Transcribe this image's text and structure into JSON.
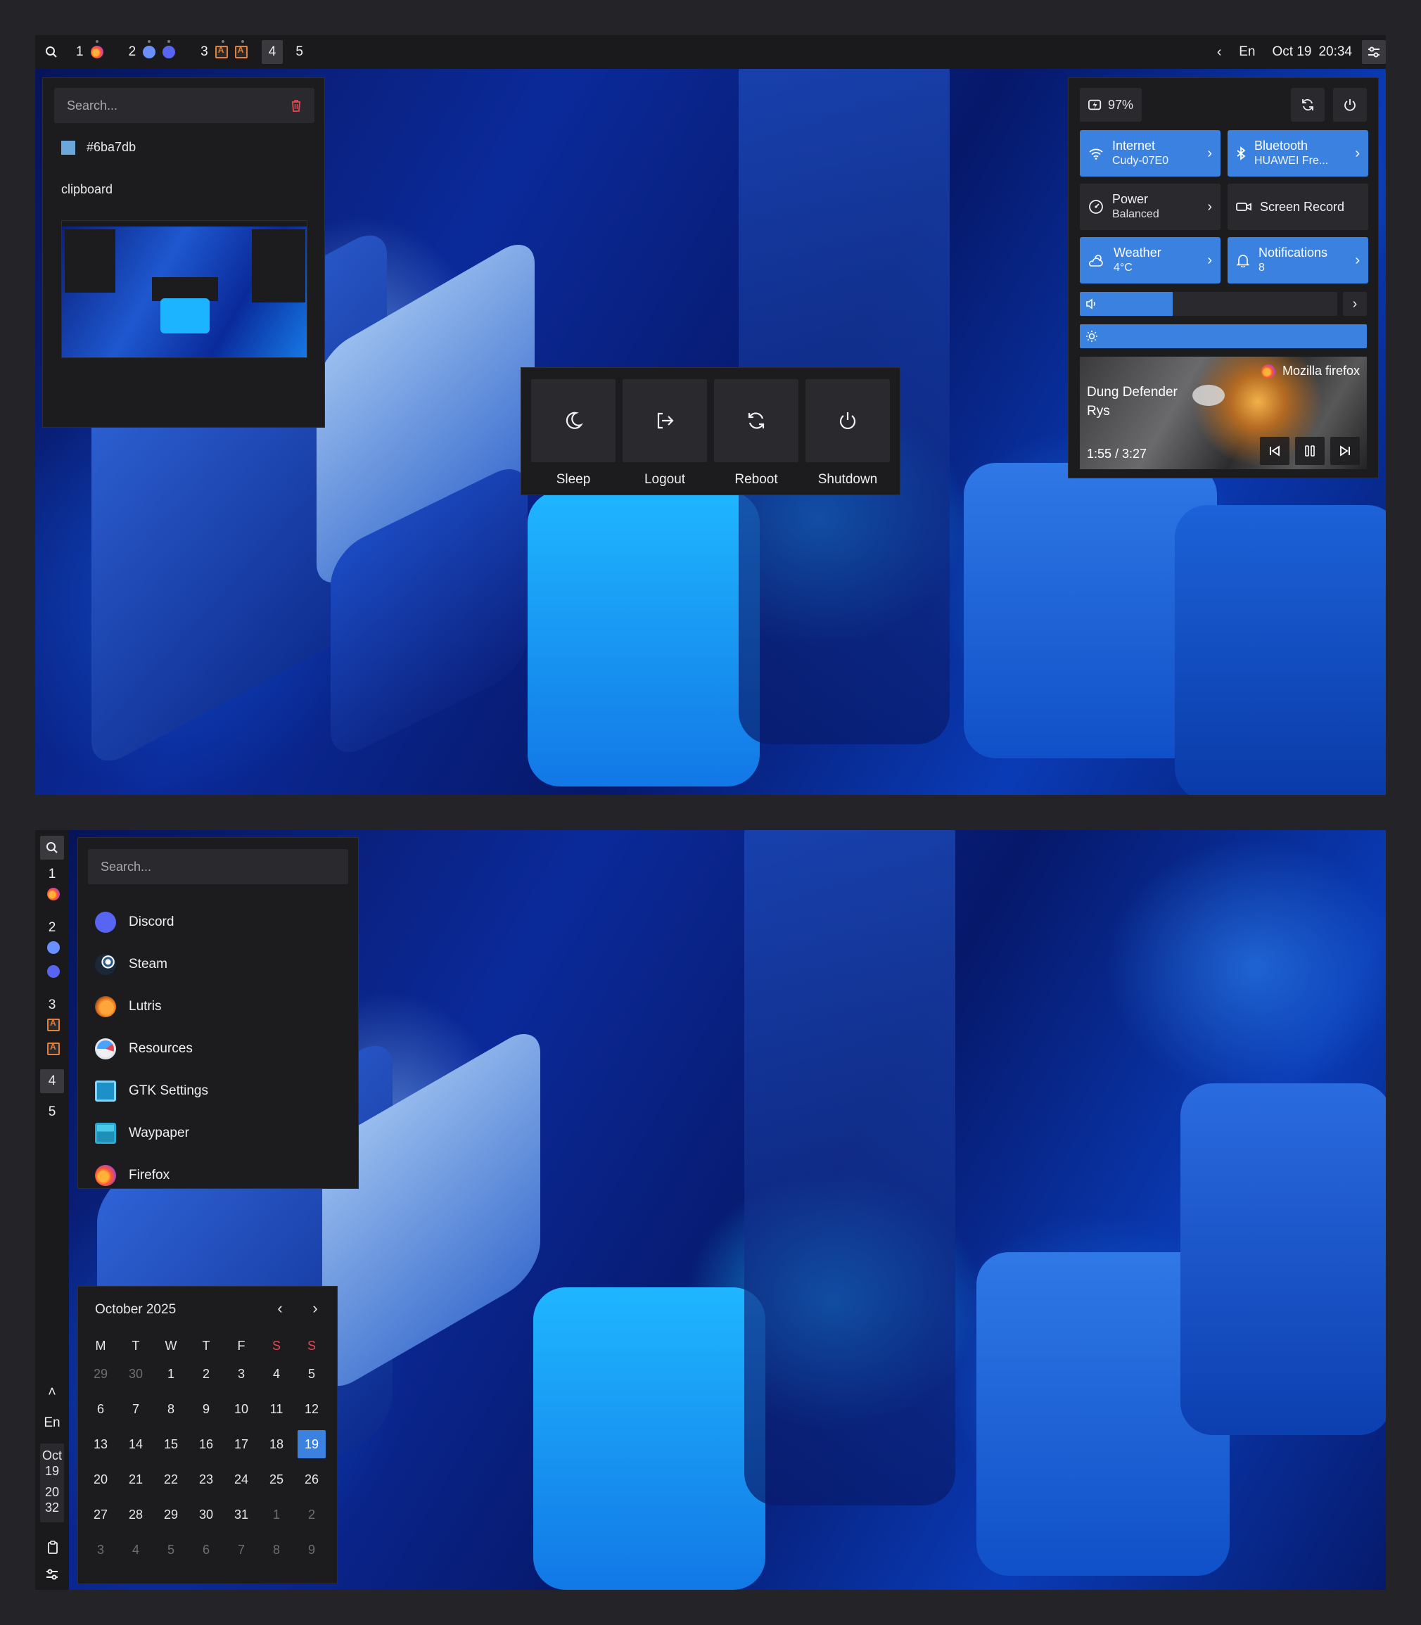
{
  "top_bar": {
    "workspaces": [
      {
        "num": "1",
        "apps": [
          "firefox-icon"
        ]
      },
      {
        "num": "2",
        "apps": [
          "transmission-icon",
          "discord-icon"
        ]
      },
      {
        "num": "3",
        "apps": [
          "ai-icon",
          "ai-icon"
        ]
      },
      {
        "num": "4",
        "apps": [],
        "active": true
      },
      {
        "num": "5",
        "apps": []
      }
    ],
    "lang": "En",
    "date": "Oct 19",
    "time": "20:34"
  },
  "clipboard": {
    "search_placeholder": "Search...",
    "items": [
      "#6ba7db",
      "clipboard"
    ],
    "swatch_color": "#6ba7db"
  },
  "power_menu": {
    "buttons": [
      "Sleep",
      "Logout",
      "Reboot",
      "Shutdown"
    ]
  },
  "quick_settings": {
    "battery": "97%",
    "tiles": [
      {
        "title": "Internet",
        "sub": "Cudy-07E0",
        "on": true
      },
      {
        "title": "Bluetooth",
        "sub": "HUAWEI Fre...",
        "on": true
      },
      {
        "title": "Power",
        "sub": "Balanced",
        "on": false
      },
      {
        "title": "Screen Record",
        "sub": "",
        "on": false
      },
      {
        "title": "Weather",
        "sub": "4°C",
        "on": true
      },
      {
        "title": "Notifications",
        "sub": "8",
        "on": true
      }
    ],
    "volume_level": 0.36,
    "brightness_level": 1.0,
    "media": {
      "player": "Mozilla firefox",
      "title": "Dung Defender",
      "artist": "Rys",
      "position": "1:55 / 3:27"
    }
  },
  "launcher": {
    "search_placeholder": "Search...",
    "apps": [
      "Discord",
      "Steam",
      "Lutris",
      "Resources",
      "GTK Settings",
      "Waypaper",
      "Firefox"
    ]
  },
  "left_bar": {
    "workspaces": [
      "1",
      "2",
      "3",
      "4",
      "5"
    ],
    "lang": "En",
    "date_month": "Oct",
    "date_day": "19",
    "time_hour": "20",
    "time_min": "32"
  },
  "calendar": {
    "title": "October 2025",
    "weekdays": [
      "M",
      "T",
      "W",
      "T",
      "F",
      "S",
      "S"
    ],
    "weeks": [
      [
        "29",
        "30",
        "1",
        "2",
        "3",
        "4",
        "5"
      ],
      [
        "6",
        "7",
        "8",
        "9",
        "10",
        "11",
        "12"
      ],
      [
        "13",
        "14",
        "15",
        "16",
        "17",
        "18",
        "19"
      ],
      [
        "20",
        "21",
        "22",
        "23",
        "24",
        "25",
        "26"
      ],
      [
        "27",
        "28",
        "29",
        "30",
        "31",
        "1",
        "2"
      ],
      [
        "3",
        "4",
        "5",
        "6",
        "7",
        "8",
        "9"
      ]
    ],
    "today": "19",
    "accent": "#3b82e0",
    "weekend_color": "#e04a57"
  }
}
